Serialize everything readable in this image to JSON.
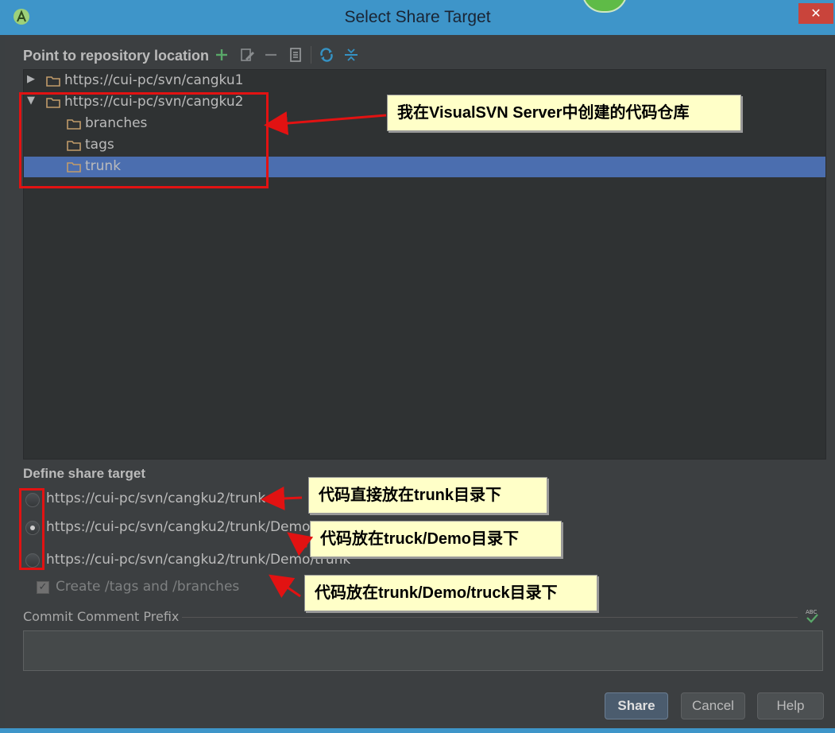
{
  "window": {
    "title": "Select Share Target",
    "close_glyph": "✕"
  },
  "repo_section": {
    "label": "Point to repository location",
    "toolbar_icons": [
      "add-icon",
      "edit-icon",
      "remove-icon",
      "browse-icon",
      "refresh-icon",
      "collapse-icon"
    ]
  },
  "tree": [
    {
      "label": "https://cui-pc/svn/cangku1",
      "expanded": false,
      "level": 0,
      "arrow": "▶"
    },
    {
      "label": "https://cui-pc/svn/cangku2",
      "expanded": true,
      "level": 0,
      "arrow": "▼"
    },
    {
      "label": "branches",
      "level": 1
    },
    {
      "label": "tags",
      "level": 1
    },
    {
      "label": "trunk",
      "level": 1,
      "selected": true
    }
  ],
  "share_section": {
    "label": "Define share target",
    "options": [
      {
        "label": "https://cui-pc/svn/cangku2/trunk",
        "selected": false
      },
      {
        "label": "https://cui-pc/svn/cangku2/trunk/Demo",
        "selected": true
      },
      {
        "label": "https://cui-pc/svn/cangku2/trunk/Demo/trunk",
        "selected": false
      }
    ],
    "create_tags_label": "Create /tags and /branches",
    "create_tags_checked": true
  },
  "commit": {
    "label": "Commit Comment Prefix",
    "value": "",
    "spell_icon_text": "ABC"
  },
  "buttons": {
    "share": "Share",
    "cancel": "Cancel",
    "help": "Help"
  },
  "annotations": [
    "我在VisualSVN Server中创建的代码仓库",
    "代码直接放在trunk目录下",
    "代码放在truck/Demo目录下",
    "代码放在trunk/Demo/truck目录下"
  ],
  "colors": {
    "selection": "#4b6eaf",
    "background": "#3c3f41",
    "callout_bg": "#ffffc8",
    "highlight_red": "#e21212",
    "title_bar": "#3e95c9"
  }
}
